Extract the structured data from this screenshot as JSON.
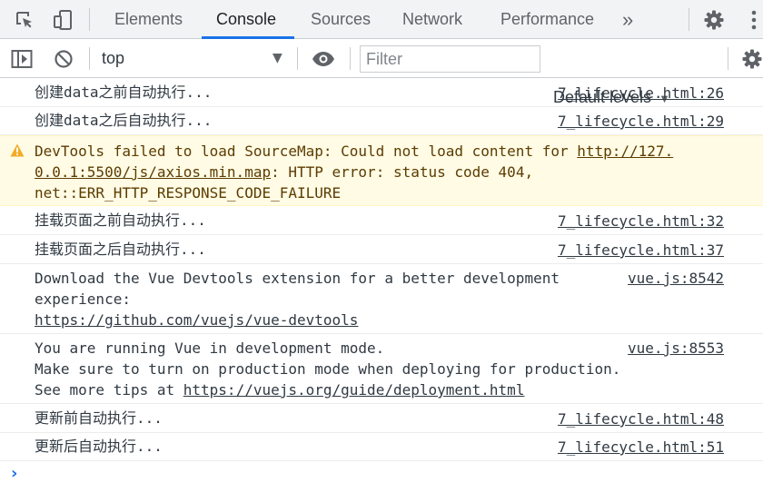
{
  "tabs": [
    {
      "label": "Elements",
      "active": false
    },
    {
      "label": "Console",
      "active": true
    },
    {
      "label": "Sources",
      "active": false
    },
    {
      "label": "Network",
      "active": false
    },
    {
      "label": "Performance",
      "active": false
    }
  ],
  "more_tabs_glyph": "»",
  "toolbar": {
    "context": "top",
    "filter_placeholder": "Filter",
    "levels": "Default levels",
    "dropdown_glyph": "▼"
  },
  "messages": [
    {
      "text": "创建data之前自动执行...",
      "source": "7_lifecycle.html:26"
    },
    {
      "text": "创建data之后自动执行...",
      "source": "7_lifecycle.html:29"
    },
    {
      "warning": {
        "line1_prefix": "DevTools failed to load SourceMap: Could not load content for ",
        "url_part1": "http://127.",
        "url_part2": "0.0.1:5500/js/axios.min.map",
        "line2_suffix": ": HTTP error: status code 404,",
        "line3": "net::ERR_HTTP_RESPONSE_CODE_FAILURE"
      }
    },
    {
      "text": "挂载页面之前自动执行...",
      "source": "7_lifecycle.html:32"
    },
    {
      "text": "挂载页面之后自动执行...",
      "source": "7_lifecycle.html:37"
    },
    {
      "line1": "Download the Vue Devtools extension for a better development",
      "line2": "experience:",
      "link": "https://github.com/vuejs/vue-devtools",
      "source": "vue.js:8542"
    },
    {
      "line1": "You are running Vue in development mode.",
      "line2": "Make sure to turn on production mode when deploying for production.",
      "line3_prefix": "See more tips at ",
      "link": "https://vuejs.org/guide/deployment.html",
      "source": "vue.js:8553"
    },
    {
      "text": "更新前自动执行...",
      "source": "7_lifecycle.html:48"
    },
    {
      "text": "更新后自动执行...",
      "source": "7_lifecycle.html:51"
    }
  ],
  "prompt_glyph": "›",
  "colors": {
    "accent": "#1a73e8",
    "warning_bg": "#fffbe5",
    "warning_text": "#5c3c00",
    "warning_icon": "#f2ab26"
  }
}
